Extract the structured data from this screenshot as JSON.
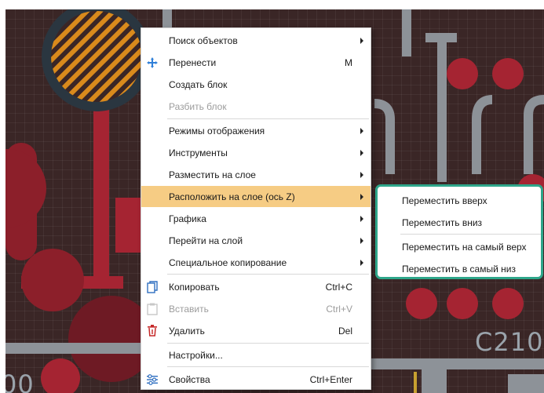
{
  "pcb": {
    "labels": {
      "designator": "C210",
      "partial_left": "00"
    },
    "colors": {
      "background": "#3a2626",
      "pad_red": "#8c1f2a",
      "trace_red": "#a52432",
      "trace_gray": "#8d9298",
      "pad_orange": "#d98a1c",
      "pad_ring": "#2a3640"
    }
  },
  "context_menu": {
    "items": [
      {
        "label": "Поиск объектов",
        "has_submenu": true
      },
      {
        "label": "Перенести",
        "shortcut": "M",
        "icon": "move-icon"
      },
      {
        "label": "Создать блок"
      },
      {
        "label": "Разбить блок",
        "disabled": true
      },
      {
        "label": "Режимы отображения",
        "has_submenu": true
      },
      {
        "label": "Инструменты",
        "has_submenu": true
      },
      {
        "label": "Разместить на слое",
        "has_submenu": true
      },
      {
        "label": "Расположить на слое (ось Z)",
        "has_submenu": true,
        "highlighted": true
      },
      {
        "label": "Графика",
        "has_submenu": true
      },
      {
        "label": "Перейти на слой",
        "has_submenu": true
      },
      {
        "label": "Специальное копирование",
        "has_submenu": true
      },
      {
        "label": "Копировать",
        "shortcut": "Ctrl+C",
        "icon": "copy-icon"
      },
      {
        "label": "Вставить",
        "shortcut": "Ctrl+V",
        "icon": "paste-icon",
        "disabled": true
      },
      {
        "label": "Удалить",
        "shortcut": "Del",
        "icon": "trash-icon"
      },
      {
        "label": "Настройки..."
      },
      {
        "label": "Свойства",
        "shortcut": "Ctrl+Enter",
        "icon": "properties-icon"
      }
    ],
    "highlight_color": "#f6cc84"
  },
  "submenu": {
    "items": [
      {
        "label": "Переместить вверх"
      },
      {
        "label": "Переместить вниз"
      },
      {
        "label": "Переместить на самый верх"
      },
      {
        "label": "Переместить в самый низ"
      }
    ],
    "border_color": "#2ea68a"
  }
}
